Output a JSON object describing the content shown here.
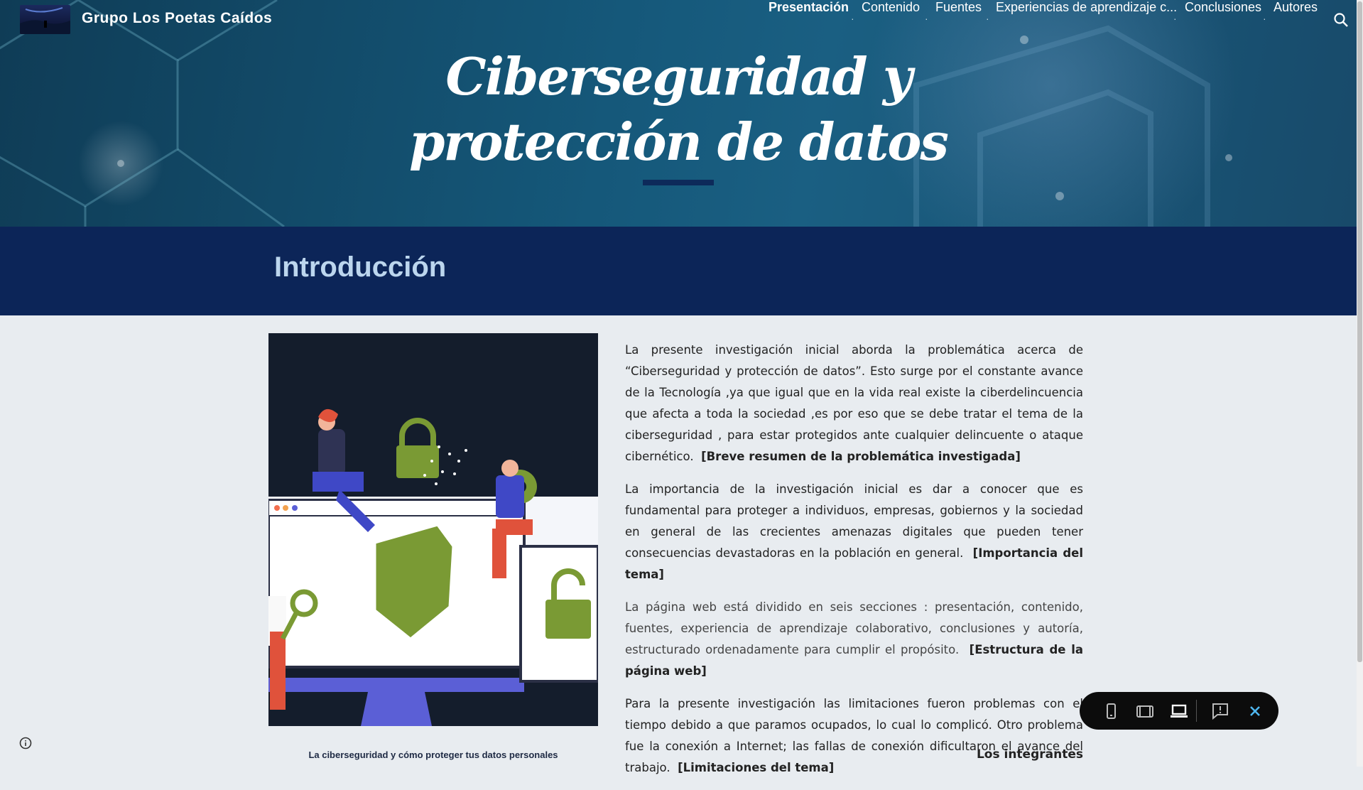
{
  "site": {
    "title": "Grupo Los Poetas Caídos"
  },
  "nav": {
    "items": [
      "Presentación",
      "Contenido",
      "Fuentes",
      "Experiencias de aprendizaje c...",
      "Conclusiones",
      "Autores"
    ],
    "active": "Presentación"
  },
  "hero": {
    "title_line1": "Ciberseguridad y",
    "title_line2": "protección de datos"
  },
  "intro": {
    "heading": "Introducción"
  },
  "illustration": {
    "caption": "La ciberseguridad y cómo proteger tus datos personales"
  },
  "paragraphs": [
    {
      "text": "La presente investigación inicial aborda la problemática acerca de “Ciberseguridad y protección de datos”. Esto surge por el constante avance de la Tecnología ,ya que igual que en la vida real existe la ciberdelincuencia que afecta a toda la sociedad ,es por eso que se debe tratar el tema de la ciberseguridad , para estar protegidos ante cualquier delincuente o ataque cibernético.",
      "tag": "[Breve resumen de la problemática investigada]"
    },
    {
      "text": "La importancia de la investigación inicial es dar a conocer que es fundamental para proteger a individuos, empresas, gobiernos y la sociedad en general de las crecientes amenazas digitales que pueden tener consecuencias devastadoras en la población en general.",
      "tag": "[Importancia del tema]"
    },
    {
      "text": "La página web está dividido en seis secciones : presentación, contenido, fuentes, experiencia de aprendizaje colaborativo, conclusiones y autoría, estructurado ordenadamente para cumplir el propósito.",
      "tag": "[Estructura de la página web]"
    },
    {
      "text": "Para la presente investigación las limitaciones fueron problemas con el tiempo debido a que paramos ocupados, lo cual lo complicó. Otro problema fue la conexión a Internet; las fallas de conexión dificultaron el avance del trabajo.",
      "tag": "[Limitaciones del tema]"
    }
  ],
  "integrantes": {
    "heading": "Los integrantes"
  },
  "colors": {
    "hero": "#15587a",
    "band": "#0c2558",
    "intro_heading": "#bcd6ee",
    "accent_close": "#4fb7f0"
  },
  "icons": [
    "search-icon",
    "info-icon",
    "phone-view-icon",
    "tablet-view-icon",
    "laptop-view-icon",
    "feedback-icon",
    "close-icon"
  ]
}
